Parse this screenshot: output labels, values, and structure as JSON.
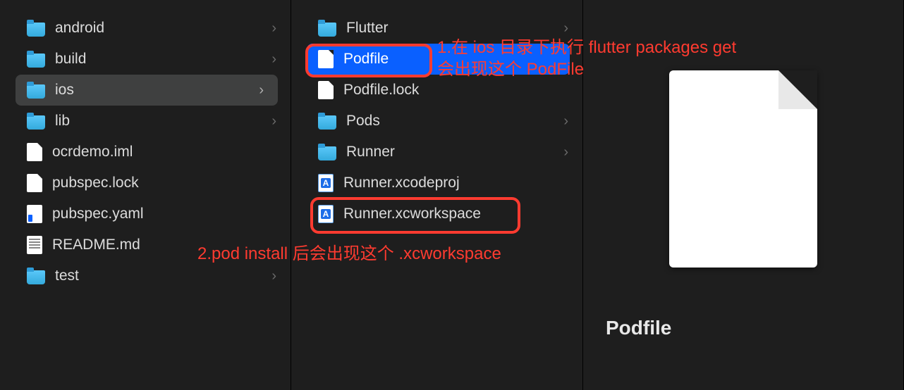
{
  "column1": {
    "items": [
      {
        "type": "folder",
        "label": "android",
        "expandable": true
      },
      {
        "type": "folder",
        "label": "build",
        "expandable": true
      },
      {
        "type": "folder",
        "label": "ios",
        "expandable": true,
        "selected": true
      },
      {
        "type": "folder",
        "label": "lib",
        "expandable": true
      },
      {
        "type": "file",
        "label": "ocrdemo.iml",
        "expandable": false
      },
      {
        "type": "file",
        "label": "pubspec.lock",
        "expandable": false
      },
      {
        "type": "yaml",
        "label": "pubspec.yaml",
        "expandable": false
      },
      {
        "type": "md",
        "label": "README.md",
        "expandable": false
      },
      {
        "type": "folder",
        "label": "test",
        "expandable": true
      }
    ]
  },
  "column2": {
    "items": [
      {
        "type": "folder",
        "label": "Flutter",
        "expandable": true
      },
      {
        "type": "file",
        "label": "Podfile",
        "expandable": false,
        "highlighted": true
      },
      {
        "type": "file",
        "label": "Podfile.lock",
        "expandable": false
      },
      {
        "type": "folder",
        "label": "Pods",
        "expandable": true
      },
      {
        "type": "folder",
        "label": "Runner",
        "expandable": true
      },
      {
        "type": "xcode",
        "label": "Runner.xcodeproj",
        "expandable": false
      },
      {
        "type": "xcode",
        "label": "Runner.xcworkspace",
        "expandable": false
      }
    ]
  },
  "preview": {
    "title": "Podfile"
  },
  "annotations": {
    "a1_line1": "1.在 ios 目录下执行 flutter packages get",
    "a1_line2": "会出现这个 PodFile",
    "a2": "2.pod install 后会出现这个 .xcworkspace"
  }
}
